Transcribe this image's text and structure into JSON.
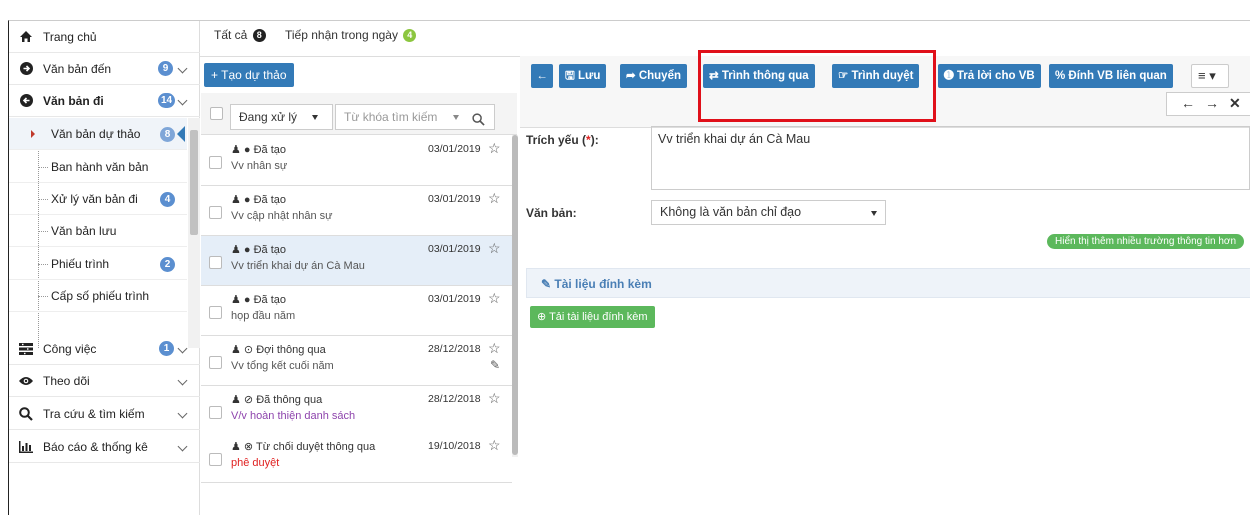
{
  "sidebar": {
    "home": "Trang chủ",
    "incoming": {
      "label": "Văn bản đến",
      "badge": "9"
    },
    "outgoing": {
      "label": "Văn bản đi",
      "badge": "14"
    },
    "sub": [
      {
        "label": "Văn bản dự thảo",
        "badge": "8"
      },
      {
        "label": "Ban hành văn bản",
        "badge": ""
      },
      {
        "label": "Xử lý văn bản đi",
        "badge": "4"
      },
      {
        "label": "Văn bản lưu",
        "badge": ""
      },
      {
        "label": "Phiếu trình",
        "badge": "2"
      },
      {
        "label": "Cấp số phiếu trình",
        "badge": ""
      }
    ],
    "work": {
      "label": "Công việc",
      "badge": "1"
    },
    "follow": {
      "label": "Theo dõi"
    },
    "search": {
      "label": "Tra cứu & tìm kiếm"
    },
    "report": {
      "label": "Báo cáo & thống kê"
    }
  },
  "tabs": {
    "all": {
      "label": "Tất cả",
      "count": "8"
    },
    "today": {
      "label": "Tiếp nhận trong ngày",
      "count": "4"
    }
  },
  "list": {
    "create_label": "+ Tạo dự thảo",
    "filter_value": "Đang xử lý",
    "search_placeholder": "Từ khóa tìm kiếm",
    "rows": [
      {
        "status": "♟ ● Đã tạo",
        "title": "Vv nhân sự",
        "date": "03/01/2019",
        "title_color": "#555"
      },
      {
        "status": "♟ ● Đã tạo",
        "title": "Vv cập nhật nhân sự",
        "date": "03/01/2019",
        "title_color": "#555"
      },
      {
        "status": "♟ ● Đã tạo",
        "title": "Vv triển khai dự án Cà Mau",
        "date": "03/01/2019",
        "title_color": "#555"
      },
      {
        "status": "♟ ● Đã tạo",
        "title": "họp đầu năm",
        "date": "03/01/2019",
        "title_color": "#555"
      },
      {
        "status": "♟ ⊙ Đợi thông qua",
        "title": "Vv tổng kết cuối năm",
        "date": "28/12/2018",
        "title_color": "#555"
      },
      {
        "status": "♟ ⊘ Đã thông qua",
        "title": "V/v hoàn thiện danh sách",
        "date": "28/12/2018",
        "title_color": "#8e44ad"
      },
      {
        "status": "♟ ⊗ Từ chối duyệt thông qua",
        "title": "phê duyệt",
        "date": "19/10/2018",
        "title_color": "#e02020"
      }
    ]
  },
  "toolbar": {
    "back": "←",
    "save": "🖫 Lưu",
    "forward": "➦ Chuyển",
    "submit_pass": "⇄ Trình thông qua",
    "submit_approve": "☞ Trình duyệt",
    "reply": "➊ Trả lời cho VB",
    "link": "% Đính VB liên quan",
    "more": "≡ ▾"
  },
  "form": {
    "summary_label": "Trích yếu (",
    "summary_req": "*",
    "summary_label_end": "):",
    "summary_value": "Vv triển khai dự án Cà Mau",
    "doc_label": "Văn bản:",
    "doc_value": "Không là văn bản chỉ đạo",
    "more_fields": "Hiển thị thêm nhiều trường thông tin hơn",
    "attach_title": "✎ Tài liệu đính kèm",
    "upload_label": "⊕ Tải tài liệu đính kèm"
  },
  "colors": {
    "primary": "#337ab7",
    "success": "#5cb85c",
    "highlight": "#e0101a",
    "badge": "#5b8fd0"
  }
}
